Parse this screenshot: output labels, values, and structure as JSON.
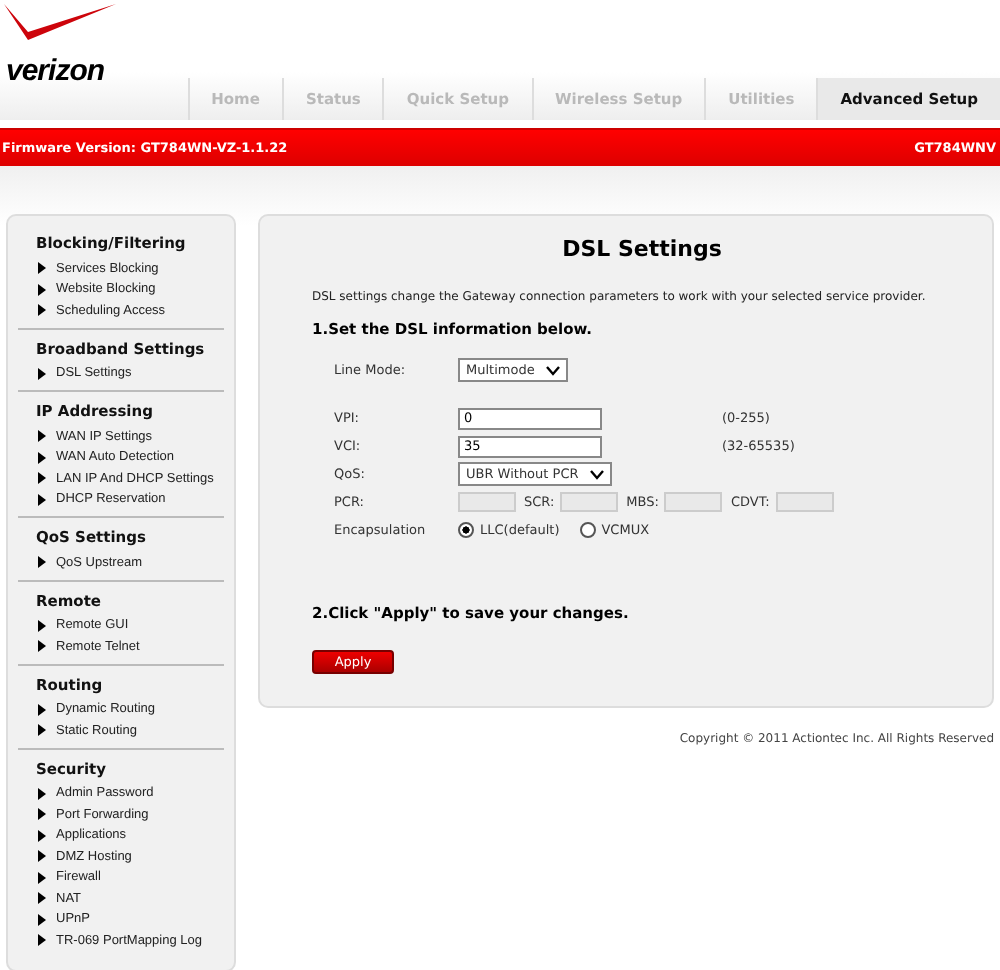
{
  "header": {
    "logo": "verizon",
    "tabs": [
      {
        "label": "Home",
        "selected": false
      },
      {
        "label": "Status",
        "selected": false
      },
      {
        "label": "Quick Setup",
        "selected": false
      },
      {
        "label": "Wireless Setup",
        "selected": false
      },
      {
        "label": "Utilities",
        "selected": false
      },
      {
        "label": "Advanced Setup",
        "selected": true
      }
    ]
  },
  "banner": {
    "firmware": "Firmware Version: GT784WN-VZ-1.1.22",
    "model": "GT784WNV"
  },
  "sidebar": {
    "sections": [
      {
        "title": "Blocking/Filtering",
        "items": [
          "Services Blocking",
          "Website Blocking",
          "Scheduling Access"
        ]
      },
      {
        "title": "Broadband Settings",
        "items": [
          "DSL Settings"
        ]
      },
      {
        "title": "IP Addressing",
        "items": [
          "WAN IP Settings",
          "WAN Auto Detection",
          "LAN IP And DHCP Settings",
          "DHCP Reservation"
        ]
      },
      {
        "title": "QoS Settings",
        "items": [
          "QoS Upstream"
        ]
      },
      {
        "title": "Remote",
        "items": [
          "Remote GUI",
          "Remote Telnet"
        ]
      },
      {
        "title": "Routing",
        "items": [
          "Dynamic Routing",
          "Static Routing"
        ]
      },
      {
        "title": "Security",
        "items": [
          "Admin Password",
          "Port Forwarding",
          "Applications",
          "DMZ Hosting",
          "Firewall",
          "NAT",
          "UPnP",
          "TR-069 PortMapping Log"
        ]
      }
    ]
  },
  "main": {
    "title": "DSL Settings",
    "description": "DSL settings change the Gateway connection parameters to work with your selected service provider.",
    "step1": "1.Set the DSL information below.",
    "line_mode": {
      "label": "Line Mode:",
      "value": "Multimode"
    },
    "vpi": {
      "label": "VPI:",
      "value": "0",
      "hint": "(0-255)"
    },
    "vci": {
      "label": "VCI:",
      "value": "35",
      "hint": "(32-65535)"
    },
    "qos": {
      "label": "QoS:",
      "value": "UBR Without PCR"
    },
    "rates": [
      {
        "label": "PCR:",
        "disabled": true
      },
      {
        "label": "SCR:",
        "disabled": true
      },
      {
        "label": "MBS:",
        "disabled": true
      },
      {
        "label": "CDVT:",
        "disabled": true
      }
    ],
    "encapsulation": {
      "label": "Encapsulation",
      "options": [
        {
          "label": "LLC(default)",
          "selected": true
        },
        {
          "label": "VCMUX",
          "selected": false
        }
      ]
    },
    "step2": "2.Click \"Apply\" to save your changes.",
    "apply": "Apply"
  },
  "footer": {
    "copyright": "Copyright © 2011 Actiontec Inc. All Rights Reserved"
  }
}
